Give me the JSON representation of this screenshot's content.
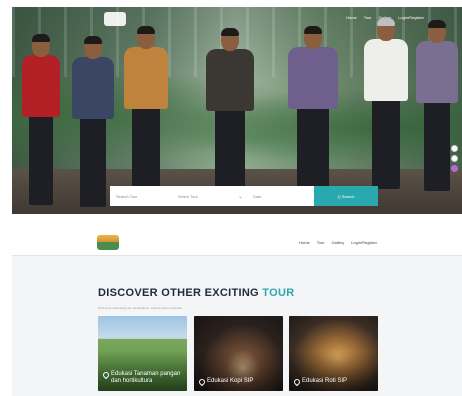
{
  "hero": {
    "nav": [
      "Home",
      "Tour",
      "Gallery",
      "Login/Register"
    ],
    "search": {
      "field1_placeholder": "Search Tour",
      "field2_placeholder": "Select Tour",
      "field3_placeholder": "Date",
      "button_label": "Q Search"
    },
    "colors": {
      "accent": "#2aa8b0"
    },
    "social_icons": [
      "whatsapp-icon",
      "location-icon",
      "instagram-icon"
    ]
  },
  "section": {
    "nav": [
      "Home",
      "Tour",
      "Gallery",
      "Login/Register"
    ],
    "title_main": "DISCOVER OTHER EXCITING ",
    "title_accent": "TOUR",
    "subtitle": "Find more interesting tour destinations. Choose them and book",
    "cards": [
      {
        "label": "Edukasi Tanaman pangan dan hortikultura",
        "icon": "location-pin-icon"
      },
      {
        "label": "Edukasi Kopi SIP",
        "icon": "location-pin-icon"
      },
      {
        "label": "Edukasi Roti SIP",
        "icon": "location-pin-icon"
      }
    ]
  }
}
